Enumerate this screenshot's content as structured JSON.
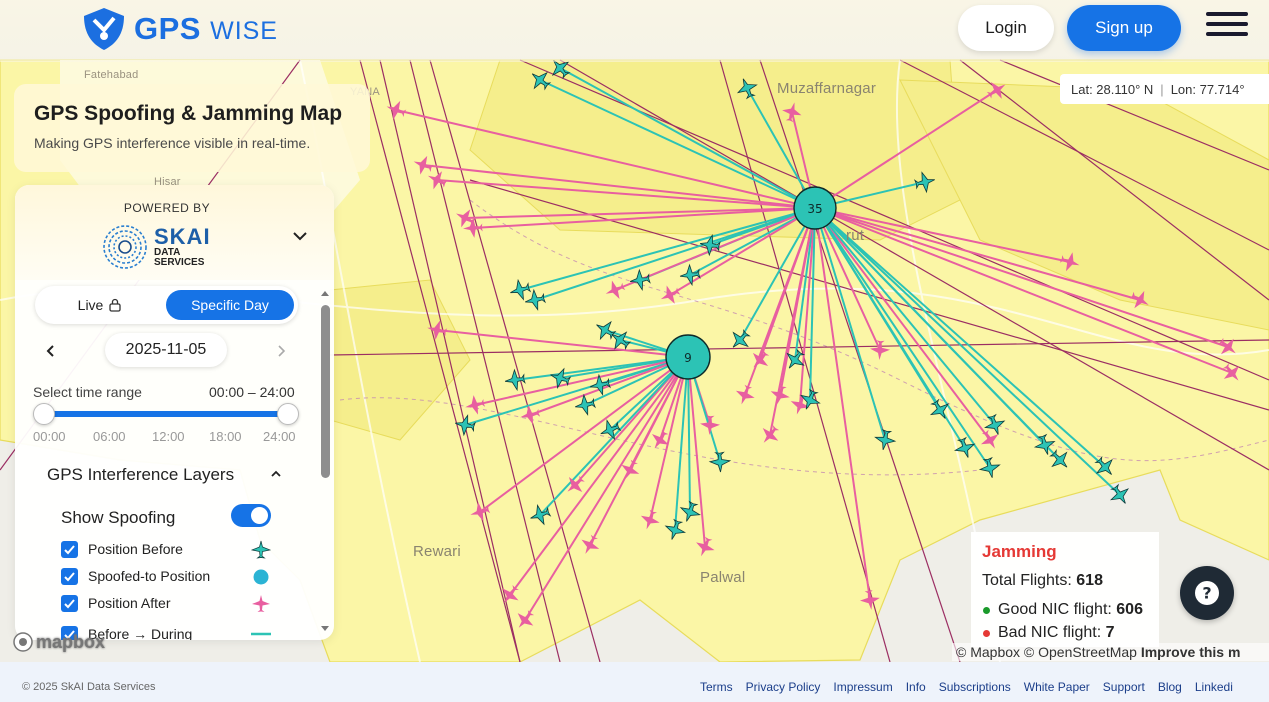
{
  "header": {
    "brand_main": "GPS",
    "brand_sub": "WISE",
    "login_label": "Login",
    "signup_label": "Sign up",
    "menu_icon": "hamburger-menu-icon"
  },
  "coordinates": {
    "lat": "Lat: 28.110° N",
    "lon": "Lon: 77.714°"
  },
  "title_card": {
    "title": "GPS Spoofing & Jamming Map",
    "subtitle": "Making GPS interference visible in real-time."
  },
  "panel": {
    "powered_by": "POWERED BY",
    "sponsor_name": "SKAI",
    "sponsor_line1": "DATA",
    "sponsor_line2": "SERVICES",
    "mode_live": "Live",
    "mode_day": "Specific Day",
    "date": "2025-11-05",
    "time_range_label": "Select time range",
    "time_range_value": "00:00 – 24:00",
    "time_range_fraction": [
      0,
      1
    ],
    "ticks": [
      "00:00",
      "06:00",
      "12:00",
      "18:00",
      "24:00"
    ],
    "layers_heading": "GPS Interference Layers",
    "show_spoofing_label": "Show Spoofing",
    "show_spoofing_on": true,
    "checks": [
      {
        "label": "Position Before",
        "checked": true,
        "icon": "teal-plane-icon"
      },
      {
        "label": "Spoofed-to Position",
        "checked": true,
        "icon": "teal-dot-icon"
      },
      {
        "label": "Position After",
        "checked": true,
        "icon": "pink-plane-icon"
      },
      {
        "label": "Before → During",
        "checked": true,
        "icon": "teal-line-icon"
      }
    ]
  },
  "map": {
    "places": [
      "Muzaffarnagar",
      "Rewari",
      "Palwal",
      "Fatehabad",
      "Hisar",
      "YANA",
      "rut"
    ],
    "clusters": [
      {
        "count": "35"
      },
      {
        "count": "9"
      }
    ],
    "colors": {
      "teal": "#2cc3b5",
      "pink": "#e85fa0",
      "zone": "#fbf7a8",
      "zone_stroke": "#e9de5c",
      "route": "#9b2e63"
    }
  },
  "jamming": {
    "title": "Jamming",
    "total_label": "Total Flights:",
    "total_value": "618",
    "good_label": "Good NIC flight:",
    "good_value": "606",
    "bad_label": "Bad NIC flight:",
    "bad_value": "7",
    "good_color": "#1a9a2a",
    "bad_color": "#e53935"
  },
  "attribution": {
    "mapbox": "© Mapbox",
    "osm": "© OpenStreetMap",
    "improve": "Improve this m",
    "logo": "mapbox"
  },
  "footer": {
    "copyright": "© 2025 SkAI Data Services",
    "links": [
      "Terms",
      "Privacy Policy",
      "Impressum",
      "Info",
      "Subscriptions",
      "White Paper",
      "Support",
      "Blog",
      "Linkedi"
    ]
  }
}
